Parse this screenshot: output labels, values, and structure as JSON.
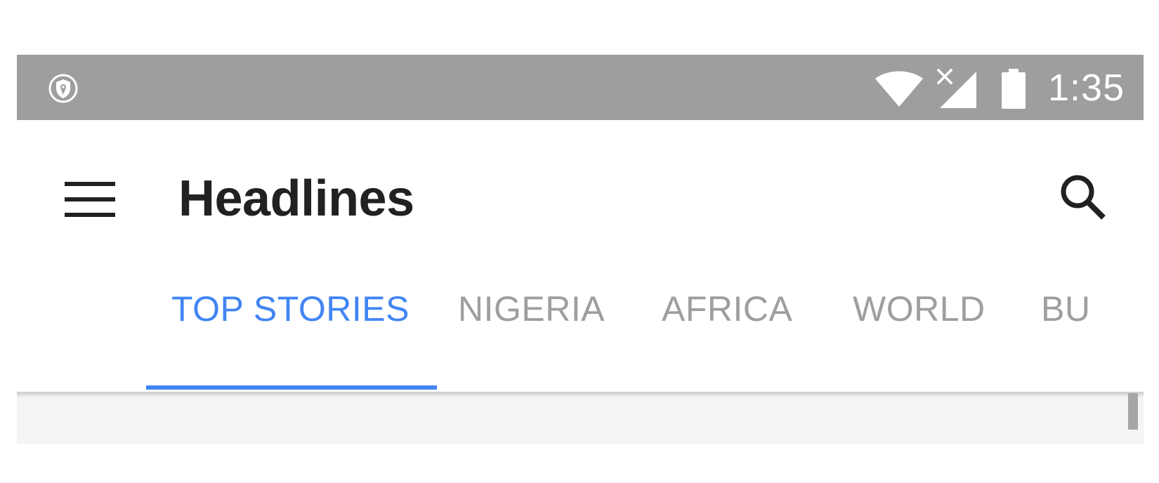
{
  "status_bar": {
    "left_icon": "shield-location-icon",
    "wifi_icon": "wifi-icon",
    "signal_icon": "no-signal-icon",
    "battery_icon": "battery-full-icon",
    "time": "1:35",
    "background_color": "#9e9e9e"
  },
  "app_bar": {
    "menu_icon": "hamburger-menu-icon",
    "title": "Headlines",
    "search_icon": "search-icon"
  },
  "tabs": {
    "active_color": "#4285f4",
    "inactive_color": "#9e9e9e",
    "items": [
      {
        "label": "TOP STORIES",
        "active": true
      },
      {
        "label": "NIGERIA",
        "active": false
      },
      {
        "label": "AFRICA",
        "active": false
      },
      {
        "label": "WORLD",
        "active": false
      },
      {
        "label": "BU",
        "active": false
      }
    ]
  }
}
